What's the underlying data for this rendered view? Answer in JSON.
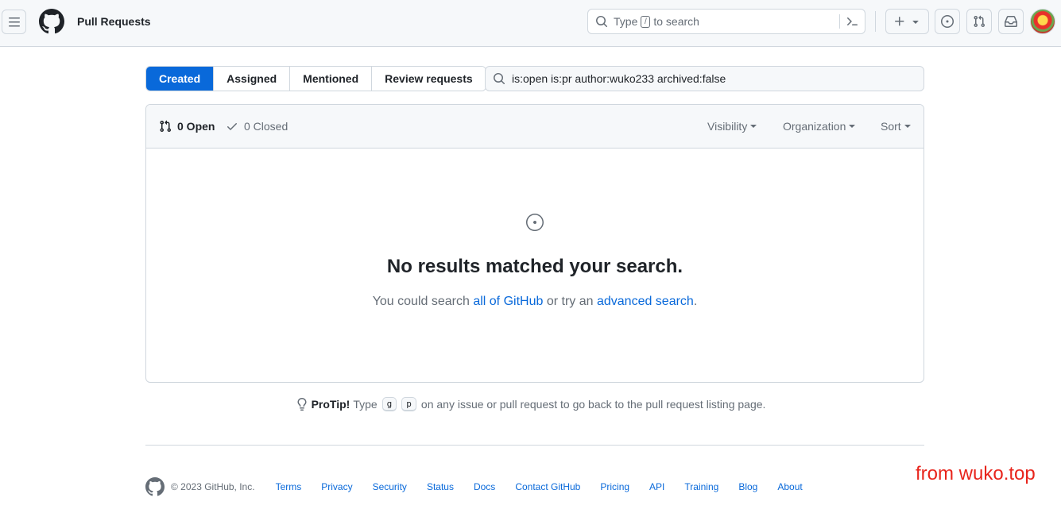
{
  "header": {
    "title": "Pull Requests",
    "search_placeholder_pre": "Type",
    "search_placeholder_key": "/",
    "search_placeholder_post": "to search"
  },
  "filters": {
    "tabs": [
      {
        "label": "Created",
        "selected": true
      },
      {
        "label": "Assigned",
        "selected": false
      },
      {
        "label": "Mentioned",
        "selected": false
      },
      {
        "label": "Review requests",
        "selected": false
      }
    ],
    "query": "is:open is:pr author:wuko233 archived:false"
  },
  "results": {
    "open_label": "0 Open",
    "closed_label": "0 Closed",
    "dropdowns": {
      "visibility": "Visibility",
      "organization": "Organization",
      "sort": "Sort"
    },
    "empty": {
      "title": "No results matched your search.",
      "text_1": "You could search",
      "link_1": "all of GitHub",
      "text_2": "or try an",
      "link_2": "advanced search",
      "text_3": "."
    }
  },
  "protip": {
    "label": "ProTip!",
    "text_1": "Type",
    "key_1": "g",
    "key_2": "p",
    "text_2": "on any issue or pull request to go back to the pull request listing page."
  },
  "footer": {
    "copyright": "© 2023 GitHub, Inc.",
    "links": [
      "Terms",
      "Privacy",
      "Security",
      "Status",
      "Docs",
      "Contact GitHub",
      "Pricing",
      "API",
      "Training",
      "Blog",
      "About"
    ]
  },
  "watermark": "from wuko.top",
  "colors": {
    "accent": "#0969da",
    "border": "#d0d7de",
    "muted": "#656d76",
    "watermark": "#e8251c"
  }
}
